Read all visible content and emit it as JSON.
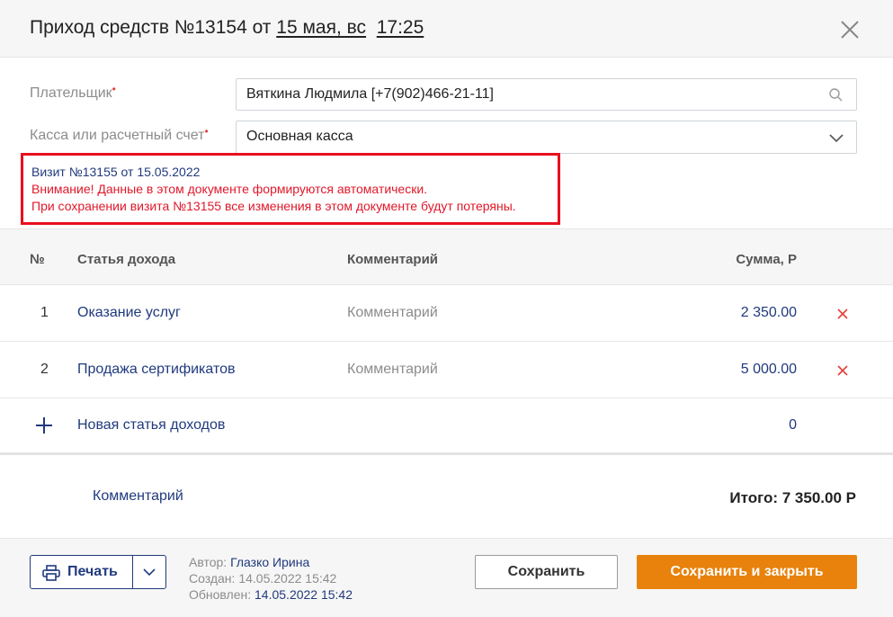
{
  "header": {
    "title_prefix": "Приход средств №13154 от",
    "date": "15 мая, вс",
    "time": "17:25"
  },
  "form": {
    "payer_label": "Плательщик",
    "payer_value": "Вяткина Людмила  [+7(902)466-21-11]",
    "account_label": "Касса или расчетный счет",
    "account_value": "Основная касса",
    "required_mark": "•"
  },
  "warning": {
    "visit": "Визит №13155 от 15.05.2022",
    "line1": "Внимание! Данные в этом документе формируются автоматически.",
    "line2": "При сохранении визита №13155 все изменения в этом документе будут потеряны."
  },
  "table": {
    "headers": {
      "num": "№",
      "article": "Статья дохода",
      "comment": "Комментарий",
      "sum": "Сумма, Р"
    },
    "rows": [
      {
        "num": "1",
        "article": "Оказание услуг",
        "comment": "Комментарий",
        "sum": "2 350.00"
      },
      {
        "num": "2",
        "article": "Продажа сертификатов",
        "comment": "Комментарий",
        "sum": "5 000.00"
      }
    ],
    "new_row": {
      "label": "Новая статья доходов",
      "sum": "0"
    }
  },
  "summary": {
    "comment_link": "Комментарий",
    "total": "Итого: 7 350.00 Р"
  },
  "footer": {
    "print_label": "Печать",
    "author_key": "Автор:",
    "author_value": "Глазко Ирина",
    "created_key": "Создан:",
    "created_value": "14.05.2022 15:42",
    "updated_key": "Обновлен:",
    "updated_value": "14.05.2022 15:42",
    "save_label": "Сохранить",
    "save_close_label": "Сохранить и закрыть"
  },
  "colors": {
    "accent_blue": "#213a7e",
    "orange": "#e8820c",
    "warning_red": "#e8101e"
  }
}
